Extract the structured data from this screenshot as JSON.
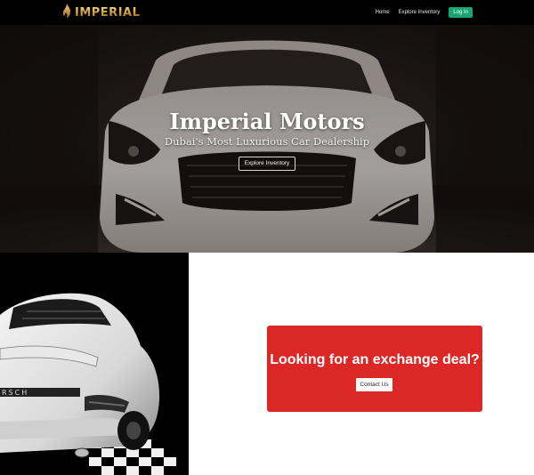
{
  "navbar": {
    "brand": "IMPERIAL",
    "brand_icon": "flame-icon",
    "links": [
      "Home",
      "Explore Inventory"
    ],
    "login_label": "Log In",
    "login_color": "#17a673"
  },
  "hero": {
    "title": "Imperial Motors",
    "subtitle": "Dubai's Most Luxurious Car Dealership",
    "cta_label": "Explore Inventory"
  },
  "exchange": {
    "heading": "Looking for an exchange deal?",
    "cta_label": "Contact Us",
    "card_color": "#dc2727"
  }
}
